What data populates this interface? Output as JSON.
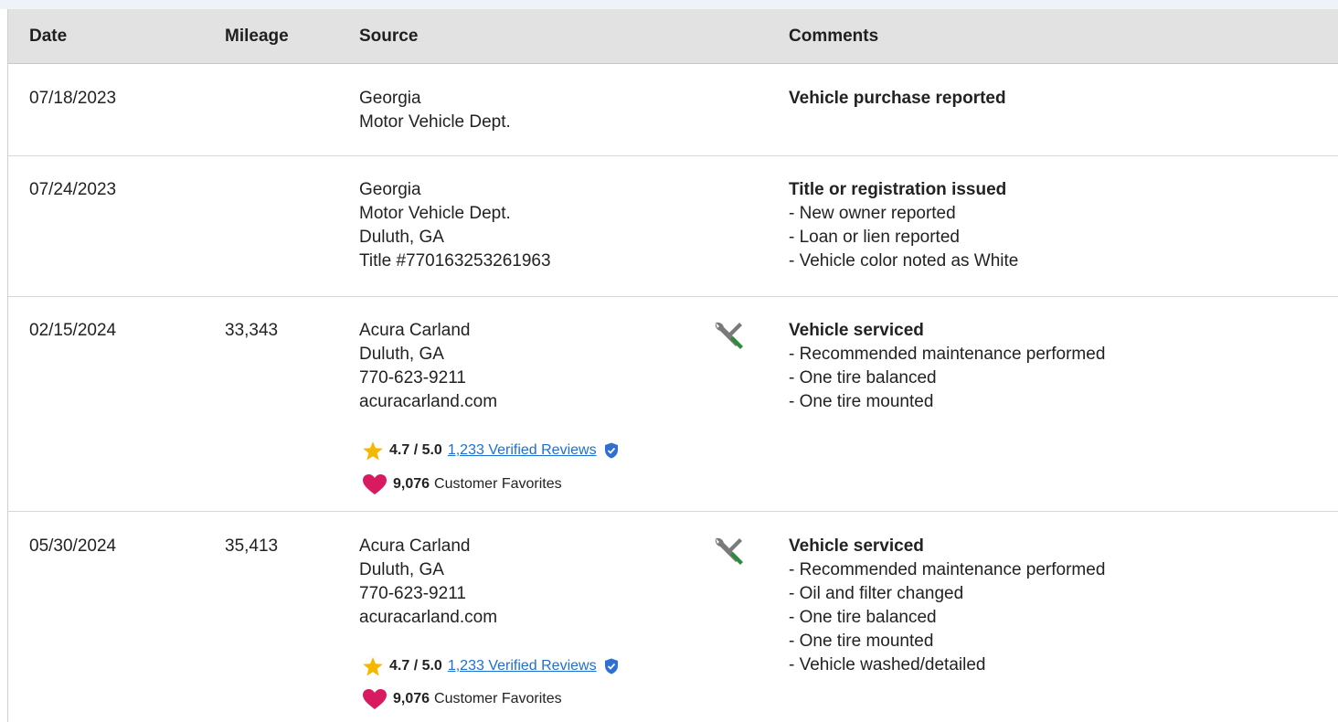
{
  "table": {
    "headers": {
      "date": "Date",
      "mileage": "Mileage",
      "source": "Source",
      "comments": "Comments"
    },
    "rows": [
      {
        "date": "07/18/2023",
        "mileage": "",
        "source": [
          "Georgia",
          "Motor Vehicle Dept."
        ],
        "comment_title": "Vehicle purchase reported",
        "comment_items": []
      },
      {
        "date": "07/24/2023",
        "mileage": "",
        "source": [
          "Georgia",
          "Motor Vehicle Dept.",
          "Duluth, GA",
          "Title #770163253261963"
        ],
        "comment_title": "Title or registration issued",
        "comment_items": [
          "- New owner reported",
          "- Loan or lien reported",
          "- Vehicle color noted as White"
        ]
      },
      {
        "date": "02/15/2024",
        "mileage": "33,343",
        "source": [
          "Acura Carland",
          "Duluth, GA",
          "770-623-9211",
          "acuracarland.com"
        ],
        "rating": "4.7 / 5.0",
        "reviews_link": "1,233 Verified Reviews",
        "favorites_count": "9,076",
        "favorites_label": "Customer Favorites",
        "service_icon": "wrench-screwdriver-icon",
        "comment_title": "Vehicle serviced",
        "comment_items": [
          "- Recommended maintenance performed",
          "- One tire balanced",
          "- One tire mounted"
        ]
      },
      {
        "date": "05/30/2024",
        "mileage": "35,413",
        "source": [
          "Acura Carland",
          "Duluth, GA",
          "770-623-9211",
          "acuracarland.com"
        ],
        "rating": "4.7 / 5.0",
        "reviews_link": "1,233 Verified Reviews",
        "favorites_count": "9,076",
        "favorites_label": "Customer Favorites",
        "service_icon": "wrench-screwdriver-icon",
        "comment_title": "Vehicle serviced",
        "comment_items": [
          "- Recommended maintenance performed",
          "- Oil and filter changed",
          "- One tire balanced",
          "- One tire mounted",
          "- Vehicle washed/detailed"
        ]
      }
    ]
  },
  "colors": {
    "header_bg": "#e2e2e2",
    "link": "#1d6fd1",
    "star": "#f5b800",
    "heart": "#d81b60",
    "verified_shield": "#2f6fd1",
    "tool_gray": "#7a7a7a",
    "tool_green": "#2e8b3a"
  }
}
